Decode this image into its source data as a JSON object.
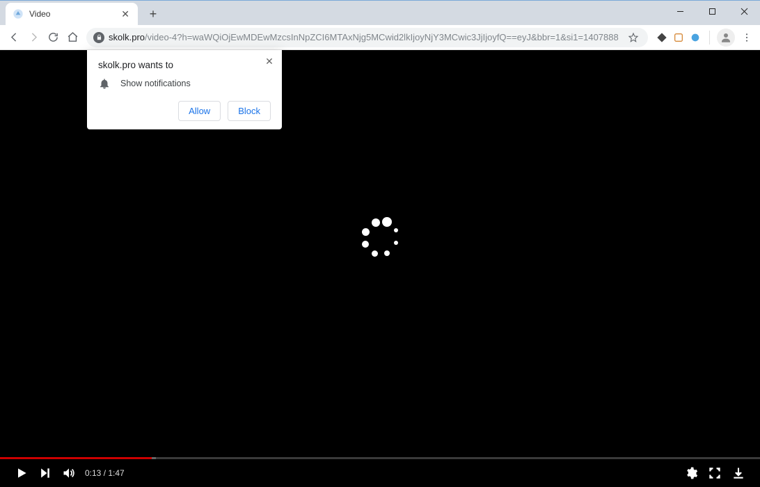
{
  "window": {
    "tab_title": "Video"
  },
  "toolbar": {
    "url_host": "skolk.pro",
    "url_path": "/video-4?h=waWQiOjEwMDEwMzcsInNpZCI6MTAxNjg5MCwid2lkIjoyNjY3MCwic3JjIjoyfQ==eyJ&bbr=1&si1=1407888"
  },
  "permission": {
    "title": "skolk.pro wants to",
    "request": "Show notifications",
    "allow": "Allow",
    "block": "Block"
  },
  "video": {
    "current_time": "0:13",
    "separator": " / ",
    "duration": "1:47"
  }
}
